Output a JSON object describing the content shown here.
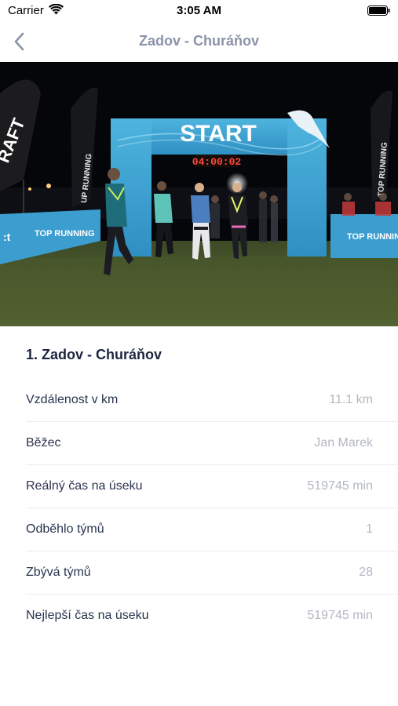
{
  "status_bar": {
    "carrier": "Carrier",
    "time": "3:05 AM"
  },
  "nav": {
    "title": "Zadov - Churáňov",
    "back_icon": "chevron-left-icon"
  },
  "hero": {
    "arch_text": "START",
    "clock_text": "04:00:02",
    "flag_left_text": "RAFT",
    "flag_mid_text": "UP RUNNING",
    "flag_right_text": "TOP RUNNING",
    "banner_left_text": "TOP RUNNING",
    "banner_right_text": "TOP RUNNING"
  },
  "section": {
    "title": "1. Zadov - Churáňov"
  },
  "rows": [
    {
      "label": "Vzdálenost v km",
      "value": "11.1 km"
    },
    {
      "label": "Běžec",
      "value": "Jan Marek"
    },
    {
      "label": "Reálný čas na úseku",
      "value": "519745 min"
    },
    {
      "label": "Odběhlo týmů",
      "value": "1"
    },
    {
      "label": "Zbývá týmů",
      "value": "28"
    },
    {
      "label": "Nejlepší čas na úseku",
      "value": "519745 min"
    }
  ],
  "colors": {
    "accent_blue": "#3fa7d6",
    "title_gray": "#8a93a8",
    "value_gray": "#b3b7c2"
  }
}
